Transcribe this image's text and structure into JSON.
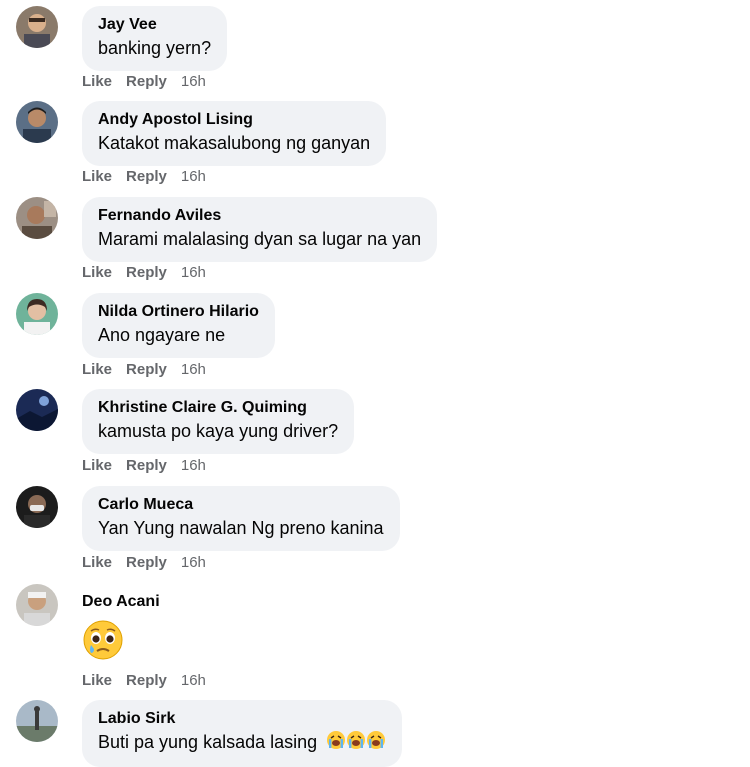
{
  "comments": [
    {
      "author": "Jay Vee",
      "text": "banking yern?",
      "like": "Like",
      "reply": "Reply",
      "time": "16h"
    },
    {
      "author": "Andy Apostol Lising",
      "text": "Katakot makasalubong ng ganyan",
      "like": "Like",
      "reply": "Reply",
      "time": "16h"
    },
    {
      "author": "Fernando Aviles",
      "text": "Marami malalasing dyan sa lugar na yan",
      "like": "Like",
      "reply": "Reply",
      "time": "16h"
    },
    {
      "author": "Nilda Ortinero Hilario",
      "text": "Ano ngayare ne",
      "like": "Like",
      "reply": "Reply",
      "time": "16h"
    },
    {
      "author": "Khristine Claire G. Quiming",
      "text": "kamusta po kaya yung driver?",
      "like": "Like",
      "reply": "Reply",
      "time": "16h"
    },
    {
      "author": "Carlo Mueca",
      "text": "Yan Yung nawalan Ng preno kanina",
      "like": "Like",
      "reply": "Reply",
      "time": "16h"
    },
    {
      "author": "Deo Acani",
      "text": "",
      "emoji": "pleading-face-with-tear",
      "like": "Like",
      "reply": "Reply",
      "time": "16h"
    },
    {
      "author": "Labio Sirk",
      "text": "Buti pa yung kalsada lasing",
      "emoji": "loudly-crying-face x3"
    }
  ],
  "colors": {
    "bubble": "#f0f2f5",
    "meta": "#65676b",
    "text": "#050505"
  }
}
